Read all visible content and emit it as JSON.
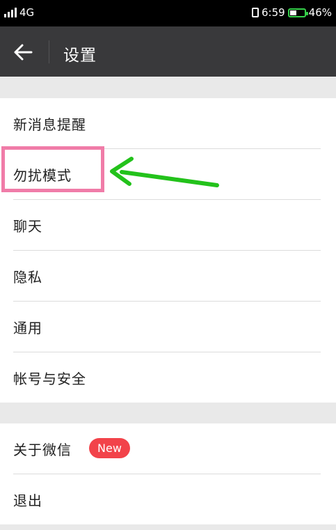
{
  "status_bar": {
    "network": "4G",
    "time": "6:59",
    "battery": "46%",
    "battery_level": 0.46,
    "icons": [
      "dual-sim-signal-icon",
      "vibrate-icon",
      "battery-icon"
    ]
  },
  "header": {
    "title": "设置",
    "back_icon": "back-arrow-icon"
  },
  "settings": {
    "group1": [
      {
        "label": "新消息提醒"
      },
      {
        "label": "勿扰模式"
      },
      {
        "label": "聊天"
      },
      {
        "label": "隐私"
      },
      {
        "label": "通用"
      },
      {
        "label": "帐号与安全"
      }
    ],
    "group2": [
      {
        "label": "关于微信",
        "badge": "New"
      },
      {
        "label": "退出"
      }
    ]
  },
  "colors": {
    "header_bg": "#39393b",
    "badge": "#f2434a",
    "highlight": "#f07ca8",
    "arrow": "#23c21b",
    "battery": "#35d04a"
  }
}
